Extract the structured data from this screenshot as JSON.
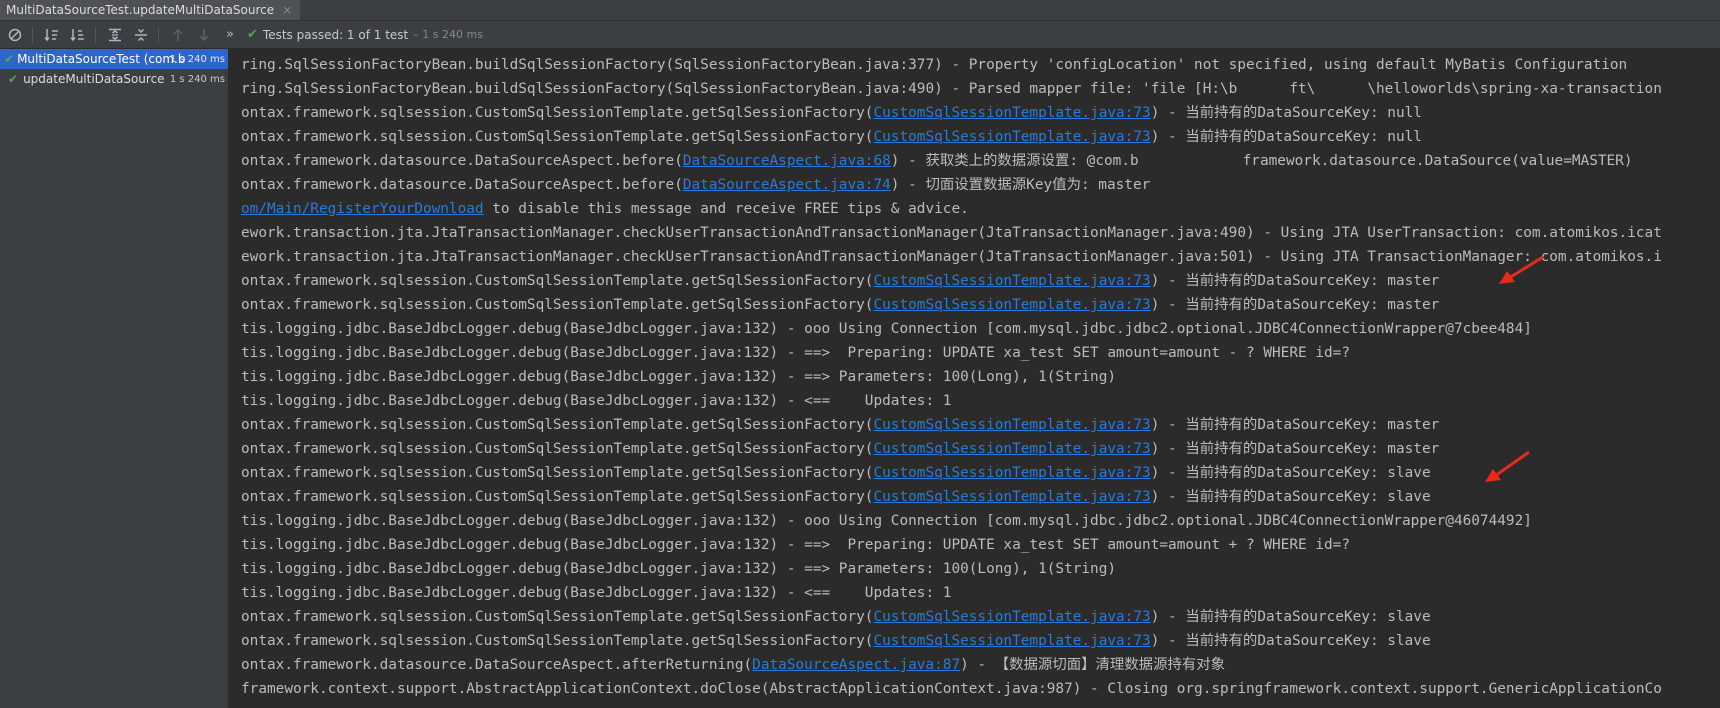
{
  "tab": {
    "title": "MultiDataSourceTest.updateMultiDataSource",
    "close": "×"
  },
  "toolbar": {
    "icons": [
      "stop-icon",
      "sort-alpha-icon",
      "sort-duration-icon",
      "expand-all-icon",
      "collapse-all-icon",
      "prev-failed-icon",
      "next-failed-icon",
      "more-icon"
    ],
    "status_text": "Tests passed: 1 of 1 test",
    "status_duration": " – 1 s 240 ms"
  },
  "tree": {
    "nodes": [
      {
        "name": "MultiDataSourceTest (com.b",
        "time": "1 s 240 ms"
      },
      {
        "name": "updateMultiDataSource",
        "time": "1 s 240 ms"
      }
    ]
  },
  "console": {
    "lines": [
      {
        "pre": "ring.SqlSessionFactoryBean.buildSqlSessionFactory(SqlSessionFactoryBean.java:377) - Property 'configLocation' not specified, using default MyBatis Configuration",
        "link": "",
        "post": ""
      },
      {
        "pre": "ring.SqlSessionFactoryBean.buildSqlSessionFactory(SqlSessionFactoryBean.java:490) - Parsed mapper file: 'file [H:\\b      ft\\      \\helloworlds\\spring-xa-transaction",
        "link": "",
        "post": ""
      },
      {
        "pre": "ontax.framework.sqlsession.CustomSqlSessionTemplate.getSqlSessionFactory(",
        "link": "CustomSqlSessionTemplate.java:73",
        "post": ") - 当前持有的DataSourceKey: null"
      },
      {
        "pre": "ontax.framework.sqlsession.CustomSqlSessionTemplate.getSqlSessionFactory(",
        "link": "CustomSqlSessionTemplate.java:73",
        "post": ") - 当前持有的DataSourceKey: null"
      },
      {
        "pre": "ontax.framework.datasource.DataSourceAspect.before(",
        "link": "DataSourceAspect.java:68",
        "post": ") - 获取类上的数据源设置: @com.b            framework.datasource.DataSource(value=MASTER)"
      },
      {
        "pre": "ontax.framework.datasource.DataSourceAspect.before(",
        "link": "DataSourceAspect.java:74",
        "post": ") - 切面设置数据源Key值为: master"
      },
      {
        "pre": "",
        "link": "om/Main/RegisterYourDownload",
        "post": " to disable this message and receive FREE tips & advice."
      },
      {
        "pre": "ework.transaction.jta.JtaTransactionManager.checkUserTransactionAndTransactionManager(JtaTransactionManager.java:490) - Using JTA UserTransaction: com.atomikos.icat",
        "link": "",
        "post": ""
      },
      {
        "pre": "ework.transaction.jta.JtaTransactionManager.checkUserTransactionAndTransactionManager(JtaTransactionManager.java:501) - Using JTA TransactionManager: com.atomikos.i",
        "link": "",
        "post": ""
      },
      {
        "pre": "ontax.framework.sqlsession.CustomSqlSessionTemplate.getSqlSessionFactory(",
        "link": "CustomSqlSessionTemplate.java:73",
        "post": ") - 当前持有的DataSourceKey: master"
      },
      {
        "pre": "ontax.framework.sqlsession.CustomSqlSessionTemplate.getSqlSessionFactory(",
        "link": "CustomSqlSessionTemplate.java:73",
        "post": ") - 当前持有的DataSourceKey: master"
      },
      {
        "pre": "tis.logging.jdbc.BaseJdbcLogger.debug(BaseJdbcLogger.java:132) - ooo Using Connection [com.mysql.jdbc.jdbc2.optional.JDBC4ConnectionWrapper@7cbee484]",
        "link": "",
        "post": ""
      },
      {
        "pre": "tis.logging.jdbc.BaseJdbcLogger.debug(BaseJdbcLogger.java:132) - ==>  Preparing: UPDATE xa_test SET amount=amount - ? WHERE id=?",
        "link": "",
        "post": ""
      },
      {
        "pre": "tis.logging.jdbc.BaseJdbcLogger.debug(BaseJdbcLogger.java:132) - ==> Parameters: 100(Long), 1(String)",
        "link": "",
        "post": ""
      },
      {
        "pre": "tis.logging.jdbc.BaseJdbcLogger.debug(BaseJdbcLogger.java:132) - <==    Updates: 1",
        "link": "",
        "post": ""
      },
      {
        "pre": "ontax.framework.sqlsession.CustomSqlSessionTemplate.getSqlSessionFactory(",
        "link": "CustomSqlSessionTemplate.java:73",
        "post": ") - 当前持有的DataSourceKey: master"
      },
      {
        "pre": "ontax.framework.sqlsession.CustomSqlSessionTemplate.getSqlSessionFactory(",
        "link": "CustomSqlSessionTemplate.java:73",
        "post": ") - 当前持有的DataSourceKey: master"
      },
      {
        "pre": "ontax.framework.sqlsession.CustomSqlSessionTemplate.getSqlSessionFactory(",
        "link": "CustomSqlSessionTemplate.java:73",
        "post": ") - 当前持有的DataSourceKey: slave"
      },
      {
        "pre": "ontax.framework.sqlsession.CustomSqlSessionTemplate.getSqlSessionFactory(",
        "link": "CustomSqlSessionTemplate.java:73",
        "post": ") - 当前持有的DataSourceKey: slave"
      },
      {
        "pre": "tis.logging.jdbc.BaseJdbcLogger.debug(BaseJdbcLogger.java:132) - ooo Using Connection [com.mysql.jdbc.jdbc2.optional.JDBC4ConnectionWrapper@46074492]",
        "link": "",
        "post": ""
      },
      {
        "pre": "tis.logging.jdbc.BaseJdbcLogger.debug(BaseJdbcLogger.java:132) - ==>  Preparing: UPDATE xa_test SET amount=amount + ? WHERE id=?",
        "link": "",
        "post": ""
      },
      {
        "pre": "tis.logging.jdbc.BaseJdbcLogger.debug(BaseJdbcLogger.java:132) - ==> Parameters: 100(Long), 1(String)",
        "link": "",
        "post": ""
      },
      {
        "pre": "tis.logging.jdbc.BaseJdbcLogger.debug(BaseJdbcLogger.java:132) - <==    Updates: 1",
        "link": "",
        "post": ""
      },
      {
        "pre": "ontax.framework.sqlsession.CustomSqlSessionTemplate.getSqlSessionFactory(",
        "link": "CustomSqlSessionTemplate.java:73",
        "post": ") - 当前持有的DataSourceKey: slave"
      },
      {
        "pre": "ontax.framework.sqlsession.CustomSqlSessionTemplate.getSqlSessionFactory(",
        "link": "CustomSqlSessionTemplate.java:73",
        "post": ") - 当前持有的DataSourceKey: slave"
      },
      {
        "pre": "ontax.framework.datasource.DataSourceAspect.afterReturning(",
        "link": "DataSourceAspect.java:87",
        "post": ") - 【数据源切面】清理数据源持有对象"
      },
      {
        "pre": "framework.context.support.AbstractApplicationContext.doClose(AbstractApplicationContext.java:987) - Closing org.springframework.context.support.GenericApplicationCo",
        "link": "",
        "post": ""
      }
    ]
  },
  "colors": {
    "background": "#2b2b2b",
    "panel": "#3c3f41",
    "text": "#bbbbbb",
    "link": "#287bde",
    "selection": "#2f65ca",
    "pass": "#4fa84b",
    "annotation_arrow": "#e8291c"
  }
}
